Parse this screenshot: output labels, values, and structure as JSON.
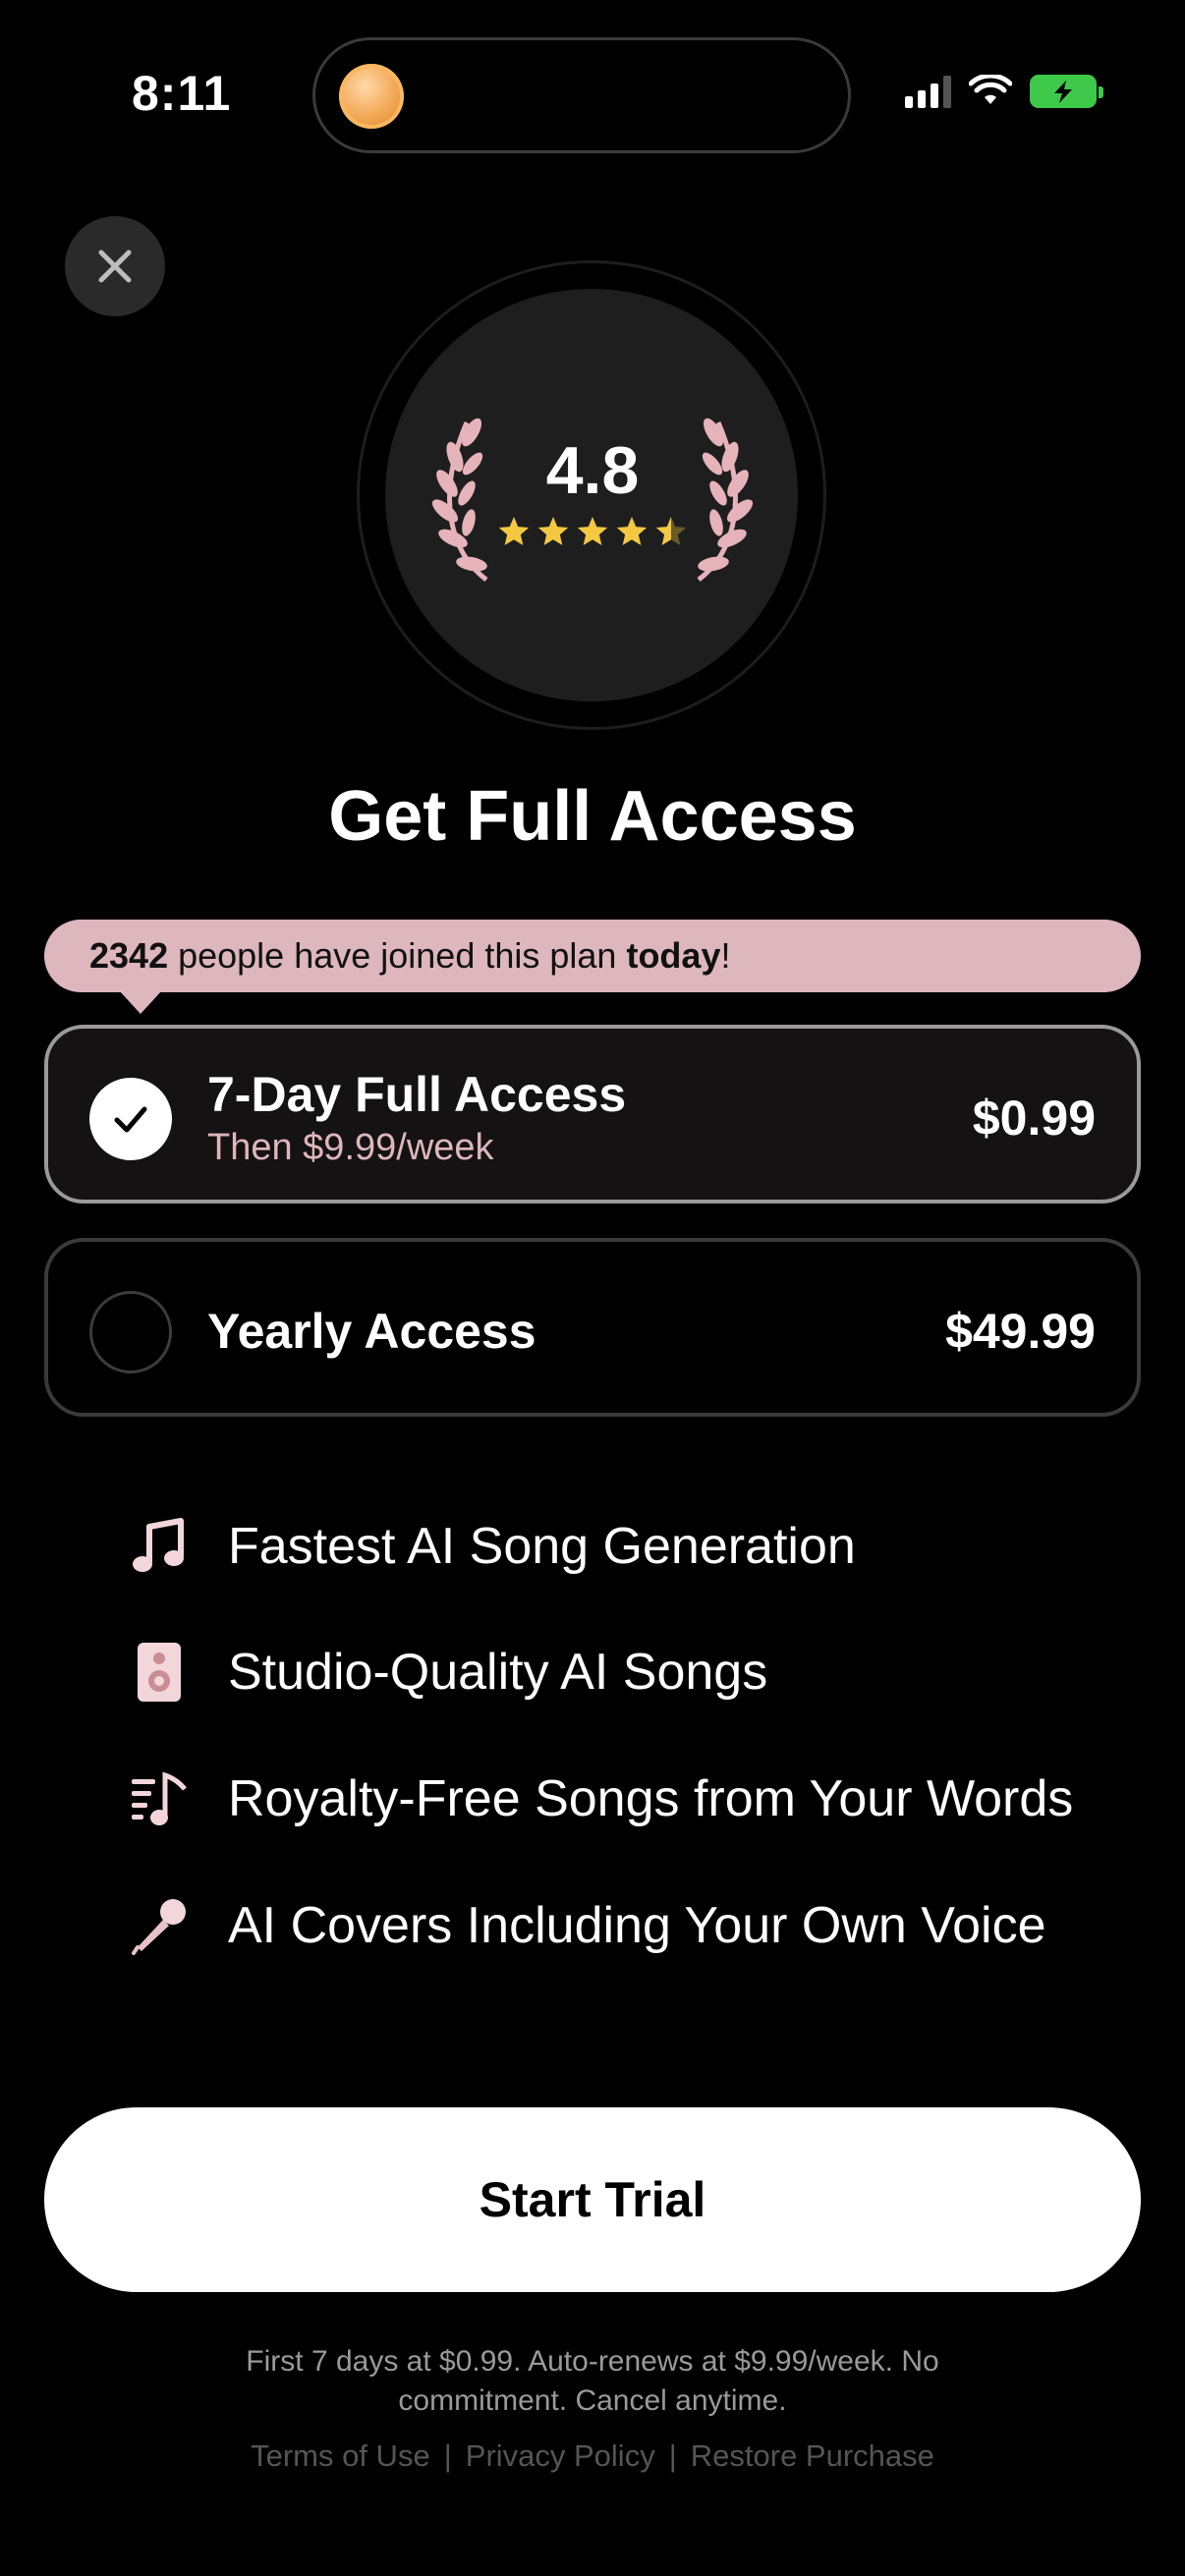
{
  "status_bar": {
    "time": "8:11"
  },
  "rating": {
    "value": "4.8",
    "stars": 4.5
  },
  "title": "Get Full Access",
  "joined_banner": {
    "count": "2342",
    "middle": " people have joined this plan ",
    "emph": "today",
    "end": "!"
  },
  "plans": [
    {
      "name": "7-Day Full Access",
      "subtitle": "Then $9.99/week",
      "price": "$0.99",
      "selected": true
    },
    {
      "name": "Yearly Access",
      "price": "$49.99",
      "selected": false
    }
  ],
  "features": [
    {
      "icon": "music-note-icon",
      "text": "Fastest AI Song Generation"
    },
    {
      "icon": "speaker-icon",
      "text": "Studio-Quality AI Songs"
    },
    {
      "icon": "lyrics-music-icon",
      "text": "Royalty-Free Songs from Your Words"
    },
    {
      "icon": "microphone-icon",
      "text": "AI Covers Including Your Own Voice"
    }
  ],
  "cta_label": "Start Trial",
  "disclaimer": "First 7 days at $0.99. Auto-renews at $9.99/week. No commitment. Cancel anytime.",
  "links": {
    "terms": "Terms of Use",
    "privacy": "Privacy Policy",
    "restore": "Restore Purchase",
    "separator": "|"
  },
  "colors": {
    "accent_pink": "#deb6bd",
    "star": "#f5c842",
    "battery": "#3ec94a"
  }
}
